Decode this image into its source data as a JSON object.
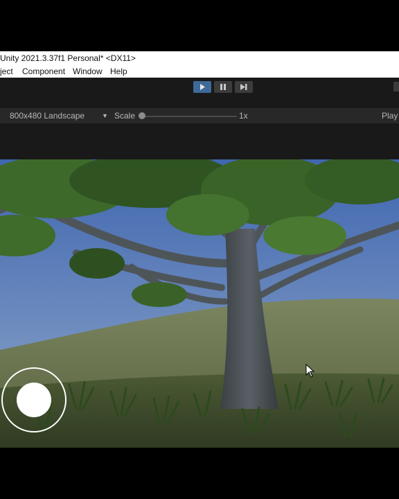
{
  "window": {
    "title": "Unity 2021.3.37f1 Personal* <DX11>"
  },
  "menu": {
    "items": [
      {
        "label": "ject"
      },
      {
        "label": "Component"
      },
      {
        "label": "Window"
      },
      {
        "label": "Help"
      }
    ]
  },
  "toolbar": {
    "play_icon": "play-icon",
    "pause_icon": "pause-icon",
    "step_icon": "step-icon",
    "play_active": true
  },
  "game_view": {
    "resolution": "800x480 Landscape",
    "scale_label": "Scale",
    "scale_value": "1x",
    "play_label": "Play"
  },
  "scene": {
    "sky_color": "#4a73b8",
    "hill_color": "#6f7a52",
    "tree_trunk_color": "#4c5358",
    "foliage_color": "#3f6a2c"
  },
  "colors": {
    "accent": "#3d6a98"
  }
}
